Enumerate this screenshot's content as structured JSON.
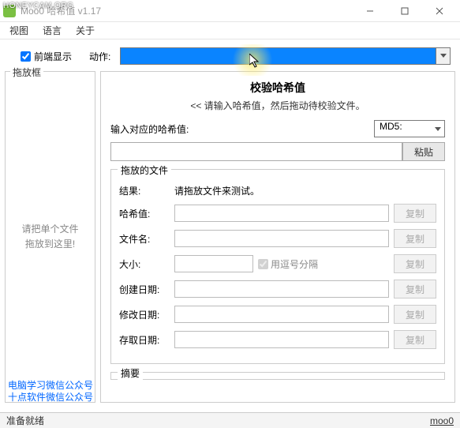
{
  "watermark_top": "HONEYCAM.ORG",
  "watermark_bottom_1": "电脑学习微信公众号",
  "watermark_bottom_2": "十点软件微信公众号",
  "title": "Moo0 哈希值 v1.17",
  "menu": {
    "view": "视图",
    "language": "语言",
    "about": "关于"
  },
  "top": {
    "front_display": "前端显示",
    "action_label": "动作:"
  },
  "left": {
    "title": "拖放框",
    "hint": "请把单个文件\n拖放到这里!"
  },
  "right": {
    "section_title": "校验哈希值",
    "hint": "<< 请输入哈希值，然后拖动待校验文件。",
    "hash_label": "输入对应的哈希值:",
    "algo": "MD5:",
    "paste": "粘贴",
    "fieldset_title": "拖放的文件",
    "result_label": "结果:",
    "result_value": "请拖放文件来测试。",
    "hash_value_label": "哈希值:",
    "filename_label": "文件名:",
    "size_label": "大小:",
    "comma_sep": "用逗号分隔",
    "create_date_label": "创建日期:",
    "modify_date_label": "修改日期:",
    "access_date_label": "存取日期:",
    "copy": "复制",
    "summary": "摘要"
  },
  "status": {
    "left": "准备就绪",
    "right": "moo0"
  }
}
